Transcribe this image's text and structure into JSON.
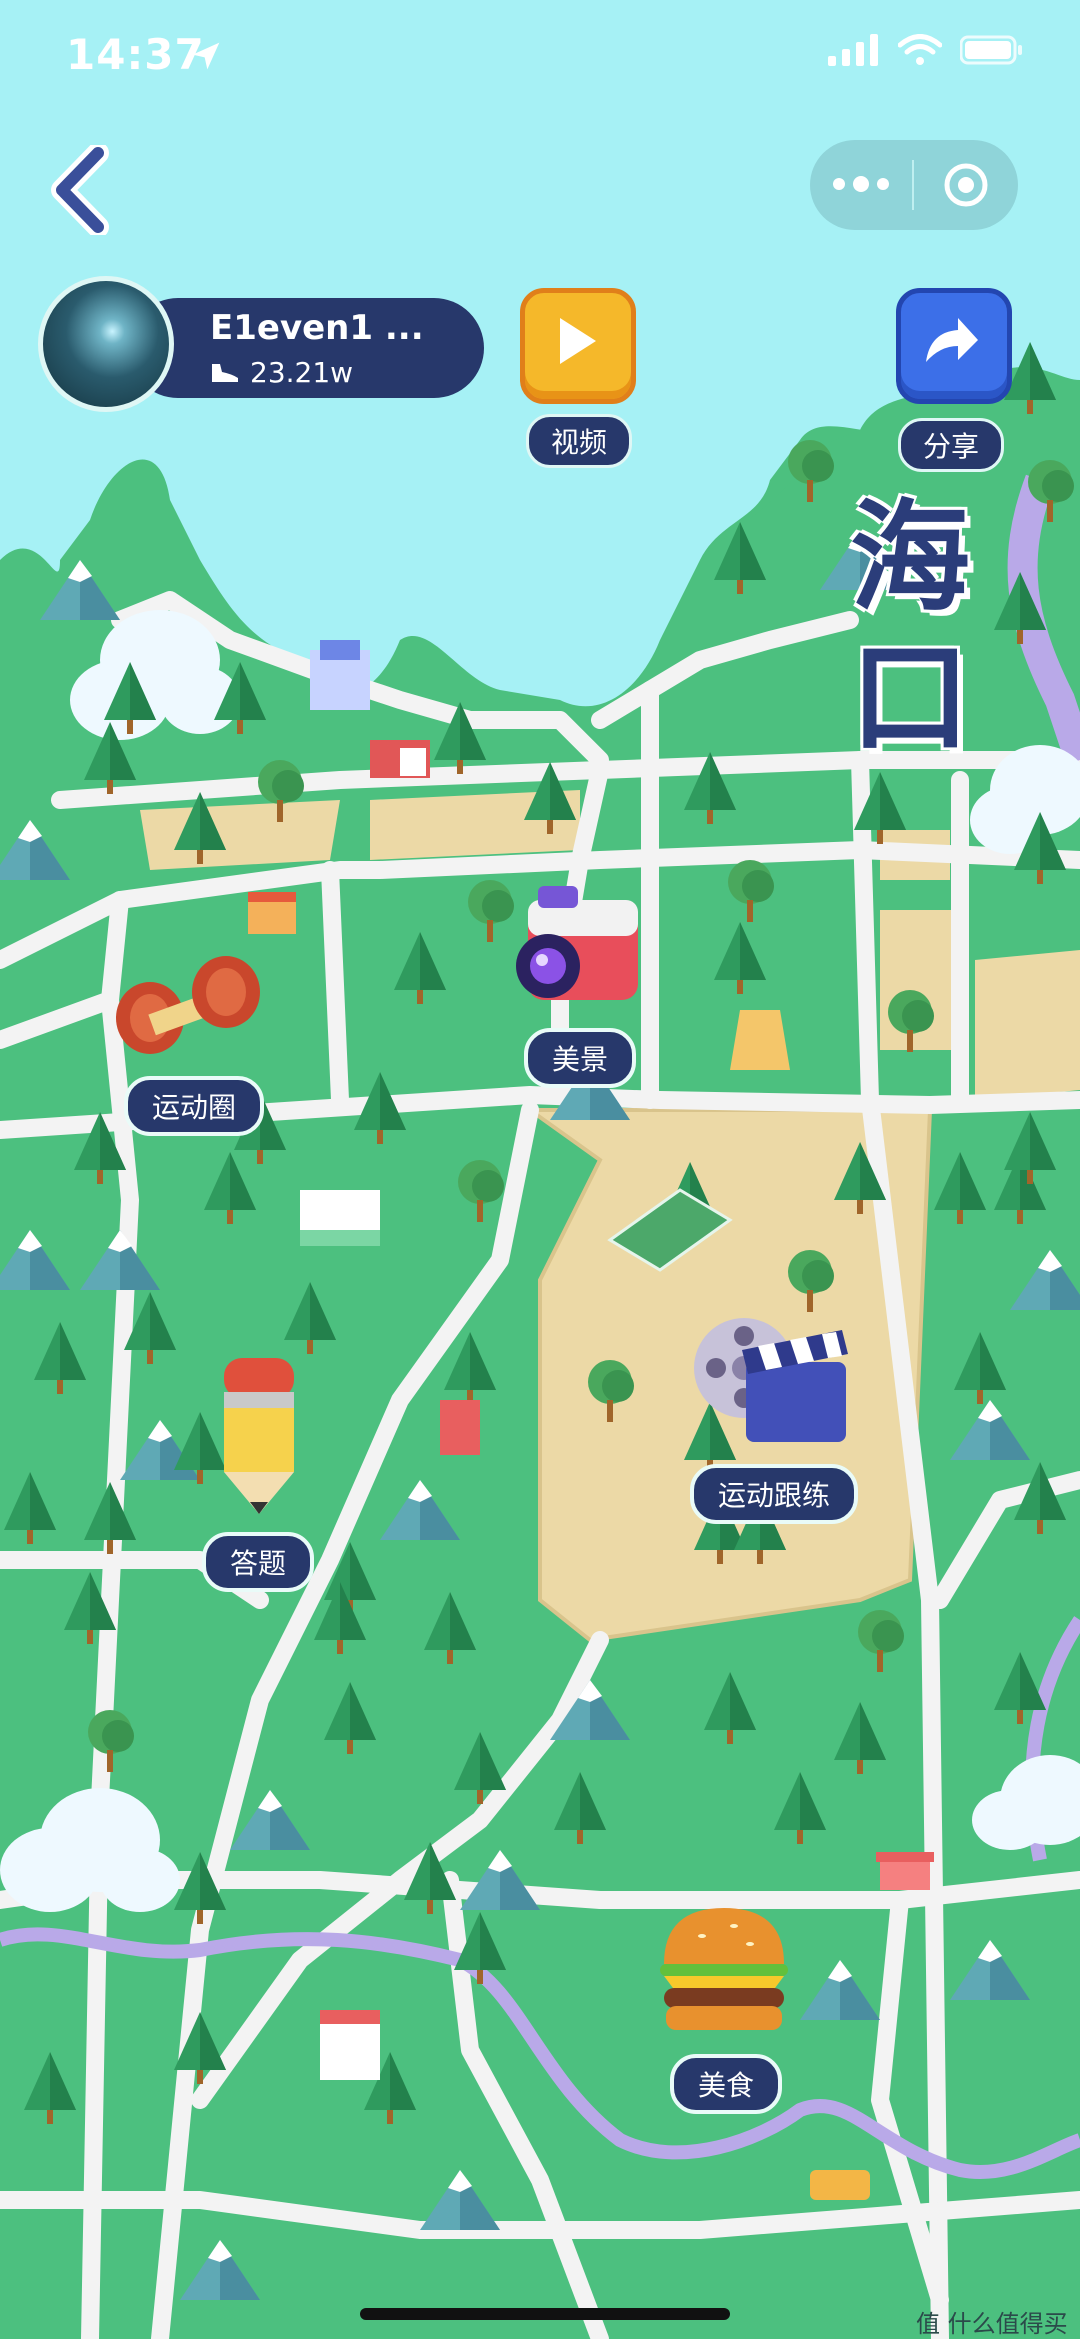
{
  "status_bar": {
    "time": "14:37"
  },
  "profile": {
    "username": "E1even1 ...",
    "steps": "23.21w"
  },
  "buttons": {
    "video_label": "视频",
    "share_label": "分享"
  },
  "city_name": {
    "line1": "海",
    "line2": "口"
  },
  "pois": {
    "sports_circle": "运动圈",
    "scenery": "美景",
    "quiz": "答题",
    "exercise_follow": "运动跟练",
    "food": "美食"
  },
  "watermark": "值 什么值得买",
  "colors": {
    "sky": "#a6f1f5",
    "land": "#4cc07f",
    "road": "#f2f2f2",
    "sand": "#ecd9a6",
    "river": "#b9a9e8",
    "navy": "#27386b"
  }
}
